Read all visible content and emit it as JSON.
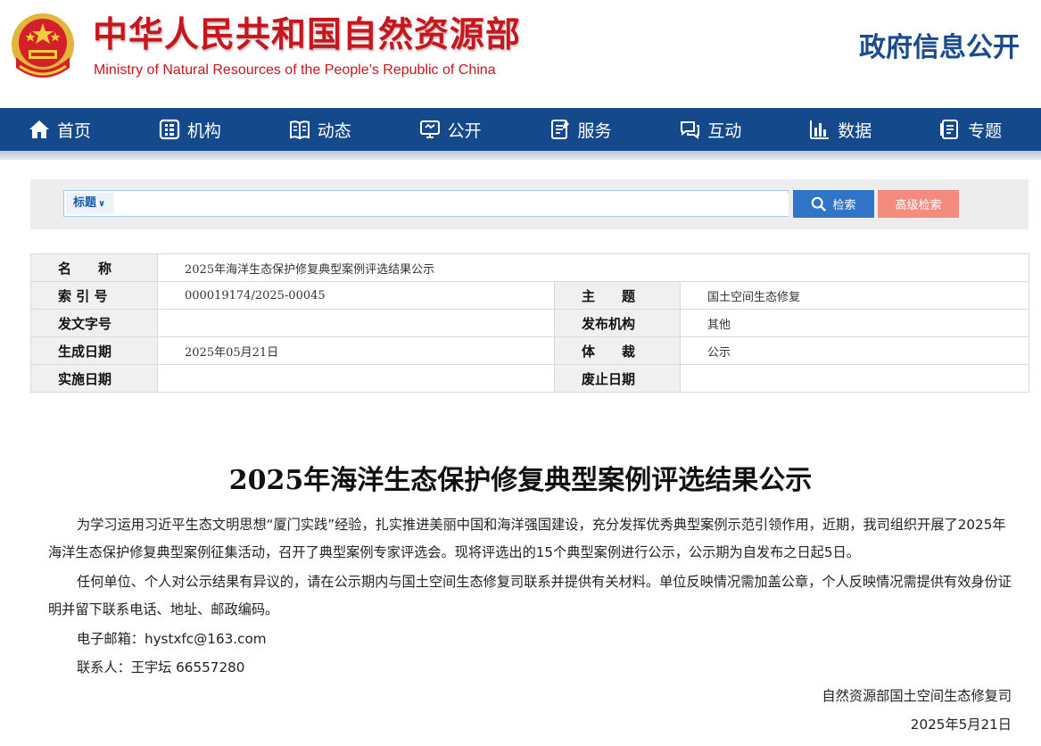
{
  "header": {
    "title_cn": "中华人民共和国自然资源部",
    "title_en": "Ministry of Natural Resources of the People’s Republic of China",
    "gov_info": "政府信息公开"
  },
  "nav": {
    "items": [
      {
        "label": "首页",
        "icon": "home-icon"
      },
      {
        "label": "机构",
        "icon": "organization-icon"
      },
      {
        "label": "动态",
        "icon": "book-icon"
      },
      {
        "label": "公开",
        "icon": "monitor-icon"
      },
      {
        "label": "服务",
        "icon": "form-icon"
      },
      {
        "label": "互动",
        "icon": "chat-icon"
      },
      {
        "label": "数据",
        "icon": "bar-chart-icon"
      },
      {
        "label": "专题",
        "icon": "topic-icon"
      }
    ]
  },
  "search": {
    "select_value": "标题",
    "placeholder": "",
    "button_label": "检索",
    "advanced_label": "高级检索"
  },
  "info": {
    "name_label": "名　　称",
    "name_value": "2025年海洋生态保护修复典型案例评选结果公示",
    "index_label": "索 引 号",
    "index_value": "000019174/2025-00045",
    "subject_label": "主　　题",
    "subject_value": "国土空间生态修复",
    "doc_no_label": "发文字号",
    "doc_no_value": "",
    "issuer_label": "发布机构",
    "issuer_value": "其他",
    "created_label": "生成日期",
    "created_value": "2025年05月21日",
    "genre_label": "体　　裁",
    "genre_value": "公示",
    "effective_label": "实施日期",
    "effective_value": "",
    "expire_label": "废止日期",
    "expire_value": ""
  },
  "article": {
    "title": "2025年海洋生态保护修复典型案例评选结果公示",
    "para1": "为学习运用习近平生态文明思想“厦门实践”经验，扎实推进美丽中国和海洋强国建设，充分发挥优秀典型案例示范引领作用，近期，我司组织开展了2025年海洋生态保护修复典型案例征集活动，召开了典型案例专家评选会。现将评选出的15个典型案例进行公示，公示期为自发布之日起5日。",
    "para2": "任何单位、个人对公示结果有异议的，请在公示期内与国土空间生态修复司联系并提供有关材料。单位反映情况需加盖公章，个人反映情况需提供有效身份证明并留下联系电话、地址、邮政编码。",
    "email": "电子邮箱：hystxfc@163.com",
    "contact": "联系人：王宇坛 66557280",
    "signature": "自然资源部国土空间生态修复司",
    "date": "2025年5月21日"
  },
  "colors": {
    "brand_red": "#c8161d",
    "nav_blue": "#144a8c",
    "search_blue": "#2f74c6",
    "advanced_red": "#f38b7e"
  }
}
